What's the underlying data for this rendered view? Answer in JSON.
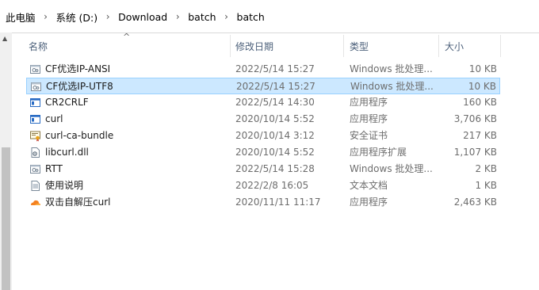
{
  "breadcrumb": [
    "此电脑",
    "系统 (D:)",
    "Download",
    "batch",
    "batch"
  ],
  "columns": {
    "name": "名称",
    "date": "修改日期",
    "type": "类型",
    "size": "大小"
  },
  "files": [
    {
      "name": "CF优选IP-ANSI",
      "date": "2022/5/14 15:27",
      "type": "Windows 批处理...",
      "size": "10 KB",
      "icon": "batch-file-icon",
      "selected": false
    },
    {
      "name": "CF优选IP-UTF8",
      "date": "2022/5/14 15:27",
      "type": "Windows 批处理...",
      "size": "10 KB",
      "icon": "batch-file-icon",
      "selected": true
    },
    {
      "name": "CR2CRLF",
      "date": "2022/5/14 14:30",
      "type": "应用程序",
      "size": "160 KB",
      "icon": "application-icon",
      "selected": false
    },
    {
      "name": "curl",
      "date": "2020/10/14 5:52",
      "type": "应用程序",
      "size": "3,706 KB",
      "icon": "application-icon",
      "selected": false
    },
    {
      "name": "curl-ca-bundle",
      "date": "2020/10/14 3:12",
      "type": "安全证书",
      "size": "217 KB",
      "icon": "certificate-icon",
      "selected": false
    },
    {
      "name": "libcurl.dll",
      "date": "2020/10/14 5:52",
      "type": "应用程序扩展",
      "size": "1,107 KB",
      "icon": "dll-file-icon",
      "selected": false
    },
    {
      "name": "RTT",
      "date": "2022/5/14 15:28",
      "type": "Windows 批处理...",
      "size": "2 KB",
      "icon": "batch-file-icon",
      "selected": false
    },
    {
      "name": "使用说明",
      "date": "2022/2/8 16:05",
      "type": "文本文档",
      "size": "1 KB",
      "icon": "text-document-icon",
      "selected": false
    },
    {
      "name": "双击自解压curl",
      "date": "2020/11/11 11:17",
      "type": "应用程序",
      "size": "2,463 KB",
      "icon": "cloudflare-app-icon",
      "selected": false
    }
  ]
}
